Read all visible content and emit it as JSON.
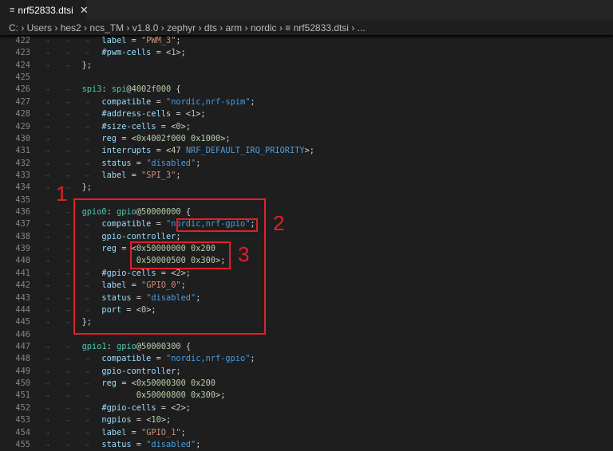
{
  "tab": {
    "title": "nrf52833.dtsi",
    "file_icon": "file-lines-icon",
    "close_icon": "close-icon"
  },
  "breadcrumb": [
    "C:",
    "Users",
    "hes2",
    "ncs_TM",
    "v1.8.0",
    "zephyr",
    "dts",
    "arm",
    "nordic",
    "nrf52833.dtsi",
    "..."
  ],
  "annotations": [
    "1",
    "2",
    "3"
  ],
  "lines": [
    {
      "n": "422",
      "i": 3,
      "t": [
        [
          "p",
          "label"
        ],
        [
          "o",
          " = "
        ],
        [
          "l",
          "\"PWM_3\""
        ],
        [
          "o",
          ";"
        ]
      ]
    },
    {
      "n": "423",
      "i": 3,
      "t": [
        [
          "p",
          "#pwm-cells"
        ],
        [
          "o",
          " = <"
        ],
        [
          "n",
          "1"
        ],
        [
          "o",
          ">;"
        ]
      ]
    },
    {
      "n": "424",
      "i": 2,
      "t": [
        [
          "o",
          "};"
        ]
      ]
    },
    {
      "n": "425",
      "i": 0,
      "t": []
    },
    {
      "n": "426",
      "i": 2,
      "t": [
        [
          "t",
          "spi3"
        ],
        [
          "o",
          ": "
        ],
        [
          "t",
          "spi"
        ],
        [
          "o",
          "@"
        ],
        [
          "n",
          "4002f000"
        ],
        [
          "o",
          " {"
        ]
      ]
    },
    {
      "n": "427",
      "i": 3,
      "t": [
        [
          "p",
          "compatible"
        ],
        [
          "o",
          " = "
        ],
        [
          "s",
          "\"nordic,nrf-spim\""
        ],
        [
          "o",
          ";"
        ]
      ]
    },
    {
      "n": "428",
      "i": 3,
      "t": [
        [
          "p",
          "#address-cells"
        ],
        [
          "o",
          " = <"
        ],
        [
          "n",
          "1"
        ],
        [
          "o",
          ">;"
        ]
      ]
    },
    {
      "n": "429",
      "i": 3,
      "t": [
        [
          "p",
          "#size-cells"
        ],
        [
          "o",
          " = <"
        ],
        [
          "n",
          "0"
        ],
        [
          "o",
          ">;"
        ]
      ]
    },
    {
      "n": "430",
      "i": 3,
      "t": [
        [
          "p",
          "reg"
        ],
        [
          "o",
          " = <"
        ],
        [
          "n",
          "0x4002f000 0x1000"
        ],
        [
          "o",
          ">;"
        ]
      ]
    },
    {
      "n": "431",
      "i": 3,
      "t": [
        [
          "p",
          "interrupts"
        ],
        [
          "o",
          " = <"
        ],
        [
          "n",
          "47 "
        ],
        [
          "c",
          "NRF_DEFAULT_IRQ_PRIORITY"
        ],
        [
          "o",
          ">;"
        ]
      ]
    },
    {
      "n": "432",
      "i": 3,
      "t": [
        [
          "p",
          "status"
        ],
        [
          "o",
          " = "
        ],
        [
          "s",
          "\"disabled\""
        ],
        [
          "o",
          ";"
        ]
      ]
    },
    {
      "n": "433",
      "i": 3,
      "t": [
        [
          "p",
          "label"
        ],
        [
          "o",
          " = "
        ],
        [
          "l",
          "\"SPI_3\""
        ],
        [
          "o",
          ";"
        ]
      ]
    },
    {
      "n": "434",
      "i": 2,
      "t": [
        [
          "o",
          "};"
        ]
      ]
    },
    {
      "n": "435",
      "i": 0,
      "t": []
    },
    {
      "n": "436",
      "i": 2,
      "t": [
        [
          "t",
          "gpio0"
        ],
        [
          "o",
          ": "
        ],
        [
          "t",
          "gpio"
        ],
        [
          "o",
          "@"
        ],
        [
          "n",
          "50000000"
        ],
        [
          "o",
          " {"
        ]
      ]
    },
    {
      "n": "437",
      "i": 3,
      "t": [
        [
          "p",
          "compatible"
        ],
        [
          "o",
          " = "
        ],
        [
          "s",
          "\"nordic,nrf-gpio\""
        ],
        [
          "o",
          ";"
        ]
      ]
    },
    {
      "n": "438",
      "i": 3,
      "t": [
        [
          "p",
          "gpio-controller"
        ],
        [
          "o",
          ";"
        ]
      ]
    },
    {
      "n": "439",
      "i": 3,
      "t": [
        [
          "p",
          "reg"
        ],
        [
          "o",
          " = <"
        ],
        [
          "n",
          "0x50000000 0x200"
        ]
      ]
    },
    {
      "n": "440",
      "i": 3,
      "t": [
        [
          "o",
          "       "
        ],
        [
          "n",
          "0x50000500 0x300"
        ],
        [
          "o",
          ">;"
        ]
      ]
    },
    {
      "n": "441",
      "i": 3,
      "t": [
        [
          "p",
          "#gpio-cells"
        ],
        [
          "o",
          " = <"
        ],
        [
          "n",
          "2"
        ],
        [
          "o",
          ">;"
        ]
      ]
    },
    {
      "n": "442",
      "i": 3,
      "t": [
        [
          "p",
          "label"
        ],
        [
          "o",
          " = "
        ],
        [
          "l",
          "\"GPIO_0\""
        ],
        [
          "o",
          ";"
        ]
      ]
    },
    {
      "n": "443",
      "i": 3,
      "t": [
        [
          "p",
          "status"
        ],
        [
          "o",
          " = "
        ],
        [
          "s",
          "\"disabled\""
        ],
        [
          "o",
          ";"
        ]
      ]
    },
    {
      "n": "444",
      "i": 3,
      "t": [
        [
          "p",
          "port"
        ],
        [
          "o",
          " = <"
        ],
        [
          "n",
          "0"
        ],
        [
          "o",
          ">;"
        ]
      ]
    },
    {
      "n": "445",
      "i": 2,
      "t": [
        [
          "o",
          "};"
        ]
      ]
    },
    {
      "n": "446",
      "i": 0,
      "t": []
    },
    {
      "n": "447",
      "i": 2,
      "t": [
        [
          "t",
          "gpio1"
        ],
        [
          "o",
          ": "
        ],
        [
          "t",
          "gpio"
        ],
        [
          "o",
          "@"
        ],
        [
          "n",
          "50000300"
        ],
        [
          "o",
          " {"
        ]
      ]
    },
    {
      "n": "448",
      "i": 3,
      "t": [
        [
          "p",
          "compatible"
        ],
        [
          "o",
          " = "
        ],
        [
          "s",
          "\"nordic,nrf-gpio\""
        ],
        [
          "o",
          ";"
        ]
      ]
    },
    {
      "n": "449",
      "i": 3,
      "t": [
        [
          "p",
          "gpio-controller"
        ],
        [
          "o",
          ";"
        ]
      ]
    },
    {
      "n": "450",
      "i": 3,
      "t": [
        [
          "p",
          "reg"
        ],
        [
          "o",
          " = <"
        ],
        [
          "n",
          "0x50000300 0x200"
        ]
      ]
    },
    {
      "n": "451",
      "i": 3,
      "t": [
        [
          "o",
          "       "
        ],
        [
          "n",
          "0x50000800 0x300"
        ],
        [
          "o",
          ">;"
        ]
      ]
    },
    {
      "n": "452",
      "i": 3,
      "t": [
        [
          "p",
          "#gpio-cells"
        ],
        [
          "o",
          " = <"
        ],
        [
          "n",
          "2"
        ],
        [
          "o",
          ">;"
        ]
      ]
    },
    {
      "n": "453",
      "i": 3,
      "t": [
        [
          "p",
          "ngpios"
        ],
        [
          "o",
          " = <"
        ],
        [
          "n",
          "10"
        ],
        [
          "o",
          ">;"
        ]
      ]
    },
    {
      "n": "454",
      "i": 3,
      "t": [
        [
          "p",
          "label"
        ],
        [
          "o",
          " = "
        ],
        [
          "l",
          "\"GPIO_1\""
        ],
        [
          "o",
          ";"
        ]
      ]
    },
    {
      "n": "455",
      "i": 3,
      "t": [
        [
          "p",
          "status"
        ],
        [
          "o",
          " = "
        ],
        [
          "s",
          "\"disabled\""
        ],
        [
          "o",
          ";"
        ]
      ]
    }
  ]
}
